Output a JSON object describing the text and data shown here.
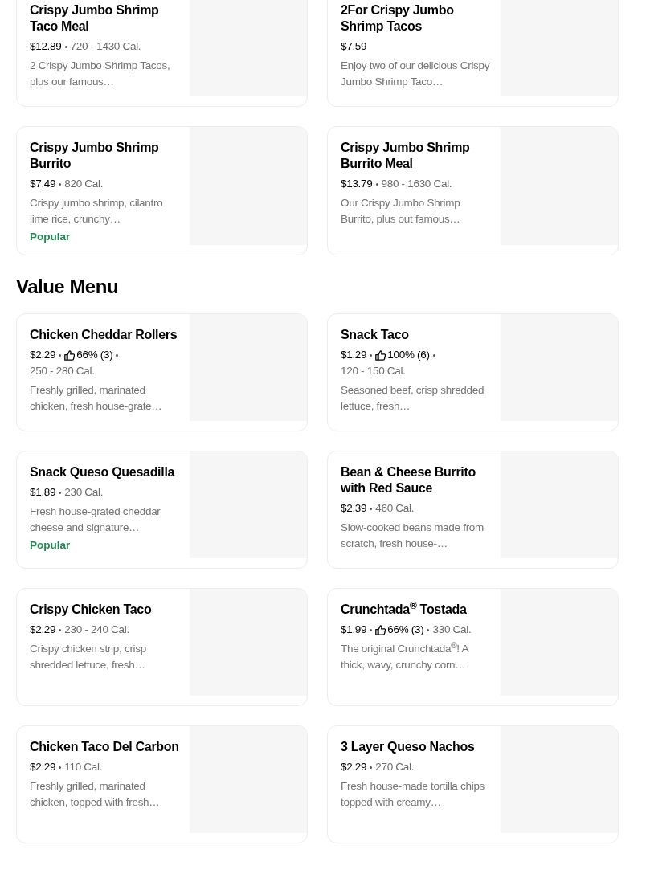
{
  "sections": [
    {
      "items": [
        {
          "title": "Crispy Jumbo Shrimp Taco Meal",
          "price": "$12.89",
          "calories": "720 - 1430 Cal.",
          "description": "2 Crispy Jumbo Shrimp Tacos, plus our famous…"
        },
        {
          "title": "2For Crispy Jumbo Shrimp Tacos",
          "price": "$7.59",
          "description": "Enjoy two of our delicious Crispy Jumbo Shrimp Taco…"
        },
        {
          "title": "Crispy Jumbo Shrimp Burrito",
          "price": "$7.49",
          "calories": "820 Cal.",
          "description": "Crispy jumbo shrimp, cilantro lime rice, crunchy…",
          "badge": "Popular"
        },
        {
          "title": "Crispy Jumbo Shrimp Burrito Meal",
          "price": "$13.79",
          "calories": "980 - 1630 Cal.",
          "description": "Our Crispy Jumbo Shrimp Burrito, plus out famous…"
        }
      ]
    },
    {
      "title": "Value Menu",
      "items": [
        {
          "title": "Chicken Cheddar Rollers",
          "price": "$2.29",
          "rating": "66% (3)",
          "calories": "250 - 280 Cal.",
          "description": "Freshly grilled, marinated chicken, fresh house-grate…"
        },
        {
          "title": "Snack Taco",
          "price": "$1.29",
          "rating": "100% (6)",
          "calories": "120 - 150 Cal.",
          "description": "Seasoned beef, crisp shredded lettuce, fresh…"
        },
        {
          "title": "Snack Queso Quesadilla",
          "price": "$1.89",
          "calories": "230 Cal.",
          "description": "Fresh house-grated cheddar cheese and signature…",
          "badge": "Popular"
        },
        {
          "title": "Bean & Cheese Burrito with Red Sauce",
          "price": "$2.39",
          "calories": "460 Cal.",
          "description": "Slow-cooked beans made from scratch, fresh house-…"
        },
        {
          "title": "Crispy Chicken Taco",
          "price": "$2.29",
          "calories": "230 - 240 Cal.",
          "description": "Crispy chicken strip, crisp shredded lettuce, fresh…"
        },
        {
          "title": "Crunchtada$^{®}$ Tostada",
          "price": "$1.99",
          "rating": "66% (3)",
          "calories": "330 Cal.",
          "description": "The original Crunchtada$^{®}$! A thick, wavy, crunchy corn…"
        },
        {
          "title": "Chicken Taco Del Carbon",
          "price": "$2.29",
          "calories": "110 Cal.",
          "description": "Freshly grilled, marinated chicken, topped with fresh…"
        },
        {
          "title": "3 Layer Queso Nachos",
          "price": "$2.29",
          "calories": "270 Cal.",
          "description": "Fresh house-made tortilla chips topped with creamy…"
        }
      ]
    }
  ]
}
